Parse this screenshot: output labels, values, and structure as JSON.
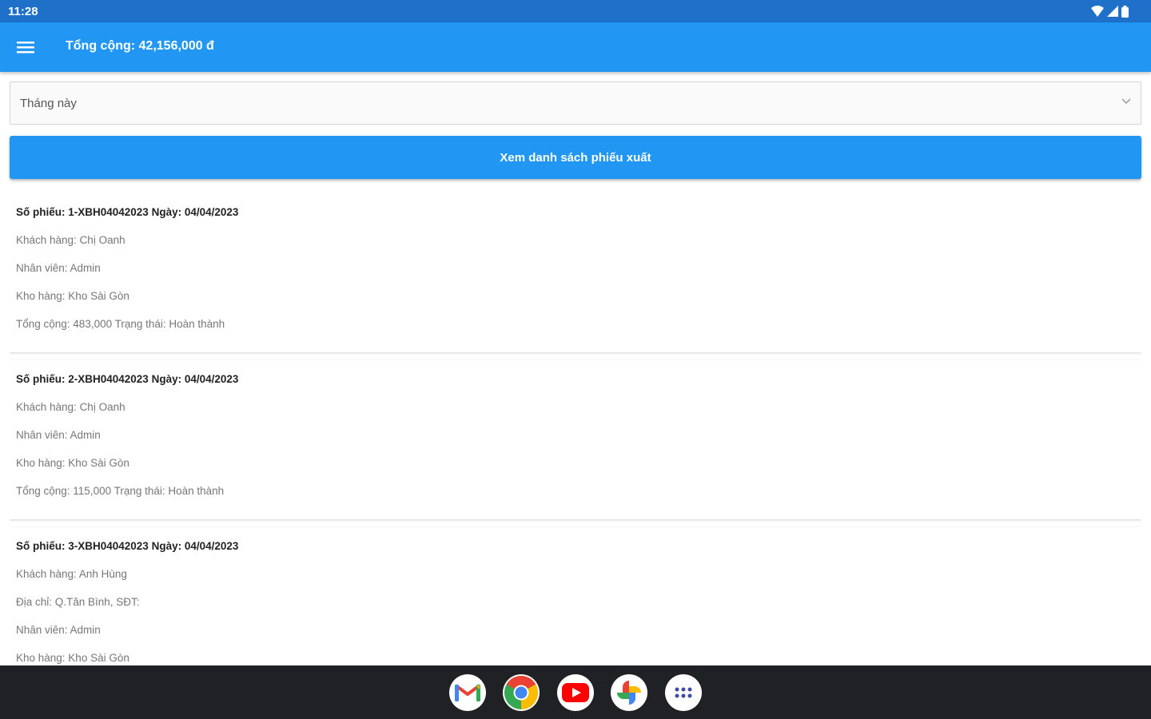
{
  "status_bar": {
    "time": "11:28"
  },
  "app_bar": {
    "total": "Tổng cộng: 42,156,000 đ"
  },
  "filter": {
    "selected": "Tháng này"
  },
  "view_button": "Xem danh sách phiếu xuất",
  "cards": [
    {
      "header": "Số phiếu: 1-XBH04042023 Ngày: 04/04/2023",
      "lines": [
        "Khách hàng: Chị Oanh",
        "Nhân viên: Admin",
        "Kho hàng: Kho Sài Gòn",
        "Tổng cộng: 483,000 Trạng thái: Hoàn thành"
      ]
    },
    {
      "header": "Số phiếu: 2-XBH04042023 Ngày: 04/04/2023",
      "lines": [
        "Khách hàng: Chị Oanh",
        "Nhân viên: Admin",
        "Kho hàng: Kho Sài Gòn",
        "Tổng cộng: 115,000 Trạng thái: Hoàn thành"
      ]
    },
    {
      "header": "Số phiếu: 3-XBH04042023 Ngày: 04/04/2023",
      "lines": [
        "Khách hàng: Anh Hùng",
        "Địa chỉ: Q.Tân Bình, SĐT:",
        "Nhân viên: Admin",
        "Kho hàng: Kho Sài Gòn"
      ]
    }
  ],
  "dock": [
    {
      "icon": "gmail-icon",
      "label": "Gmail"
    },
    {
      "icon": "chrome-icon",
      "label": "Chrome"
    },
    {
      "icon": "youtube-icon",
      "label": "YouTube"
    },
    {
      "icon": "photos-icon",
      "label": "Photos"
    },
    {
      "icon": "app-drawer-icon",
      "label": "Apps"
    }
  ],
  "colors": {
    "app_bar": "#2196f3",
    "status_bar": "#1e70c8",
    "taskbar": "#202124"
  }
}
